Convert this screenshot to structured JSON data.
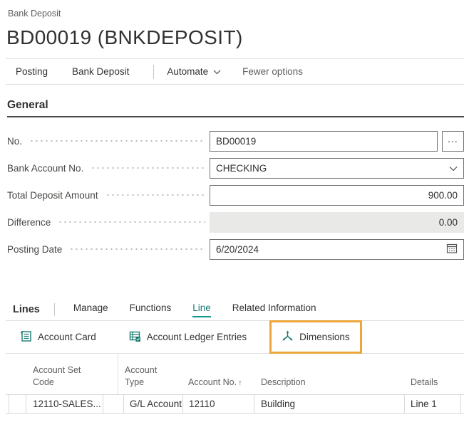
{
  "colors": {
    "accent_teal": "#1b7a70",
    "tab_underline_teal": "#16978a",
    "highlight_orange": "#eda63a",
    "text_dark": "#323130",
    "text_gray": "#605e5c",
    "separator_light": "#e1dfdd",
    "input_border": "#717171",
    "disabled_fill": "#e9e9e7"
  },
  "breadcrumb": {
    "label": "Bank Deposit"
  },
  "page": {
    "title": "BD00019 (BNKDEPOSIT)"
  },
  "action_bar": {
    "posting": "Posting",
    "bank_deposit": "Bank Deposit",
    "automate": "Automate",
    "fewer_options": "Fewer options"
  },
  "general": {
    "heading": "General",
    "fields": {
      "no": {
        "label": "No.",
        "value": "BD00019",
        "assist_glyph": "..."
      },
      "bank_account_no": {
        "label": "Bank Account No.",
        "value": "CHECKING"
      },
      "total_deposit_amount": {
        "label": "Total Deposit Amount",
        "value": "900.00"
      },
      "difference": {
        "label": "Difference",
        "value": "0.00"
      },
      "posting_date": {
        "label": "Posting Date",
        "value": "6/20/2024"
      }
    }
  },
  "lines": {
    "heading": "Lines",
    "tabs": {
      "manage": "Manage",
      "functions": "Functions",
      "line": "Line",
      "related_information": "Related Information"
    },
    "active_tab": "Line",
    "toolbar": {
      "account_card": "Account Card",
      "account_ledger_entries": "Account Ledger Entries",
      "dimensions": "Dimensions"
    }
  },
  "table": {
    "columns": {
      "account_set_code": "Account Set Code",
      "account_type": "Account Type",
      "account_no": "Account No.",
      "account_no_sort": "↑",
      "description": "Description",
      "details": "Details"
    },
    "row": {
      "account_set_code": "12110-SALES...",
      "account_type": "G/L Account",
      "account_no": "12110",
      "description": "Building",
      "details": "Line 1"
    }
  }
}
